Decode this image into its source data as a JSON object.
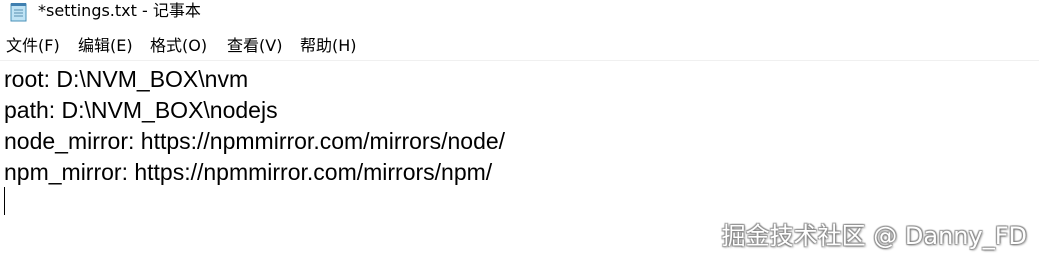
{
  "window": {
    "icon": "notepad-icon",
    "title": "*settings.txt - 记事本"
  },
  "menu": {
    "file": "文件(F)",
    "edit": "编辑(E)",
    "format": "格式(O)",
    "view": "查看(V)",
    "help": "帮助(H)"
  },
  "editor": {
    "lines": [
      "root: D:\\NVM_BOX\\nvm",
      "path: D:\\NVM_BOX\\nodejs",
      "node_mirror: https://npmmirror.com/mirrors/node/",
      "npm_mirror: https://npmmirror.com/mirrors/npm/"
    ]
  },
  "watermark": "掘金技术社区 @ Danny_FD"
}
